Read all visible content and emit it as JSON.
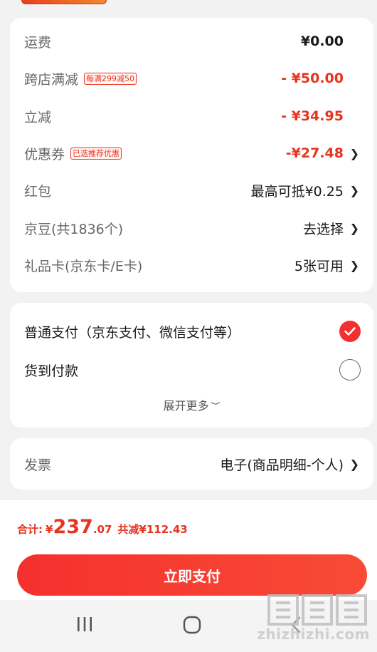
{
  "fees": {
    "freight": {
      "label": "运费",
      "value": "¥0.00"
    },
    "cross_store": {
      "label": "跨店满减",
      "tag": "每满299减50",
      "value": "- ¥50.00"
    },
    "instant": {
      "label": "立减",
      "value": "- ¥34.95"
    },
    "coupon": {
      "label": "优惠券",
      "tag": "已选推荐优惠",
      "value": "-¥27.48"
    },
    "red_packet": {
      "label": "红包",
      "value": "最高可抵¥0.25"
    },
    "jd_beans": {
      "label": "京豆(共1836个)",
      "value": "去选择"
    },
    "gift_card": {
      "label": "礼品卡(京东卡/E卡)",
      "value": "5张可用"
    }
  },
  "payment": {
    "normal": {
      "label": "普通支付（京东支付、微信支付等）",
      "selected": true
    },
    "cod": {
      "label": "货到付款",
      "selected": false
    },
    "expand_label": "展开更多"
  },
  "invoice": {
    "label": "发票",
    "value": "电子(商品明细-个人)"
  },
  "footer": {
    "total_label": "合计:",
    "currency": "¥",
    "total_integer": "237",
    "total_decimal": ".07",
    "discount": "共减¥112.43",
    "pay_button": "立即支付"
  },
  "watermark": "zhizhizhi.com",
  "colors": {
    "accent": "#f2302f",
    "price_red": "#e8331f"
  }
}
